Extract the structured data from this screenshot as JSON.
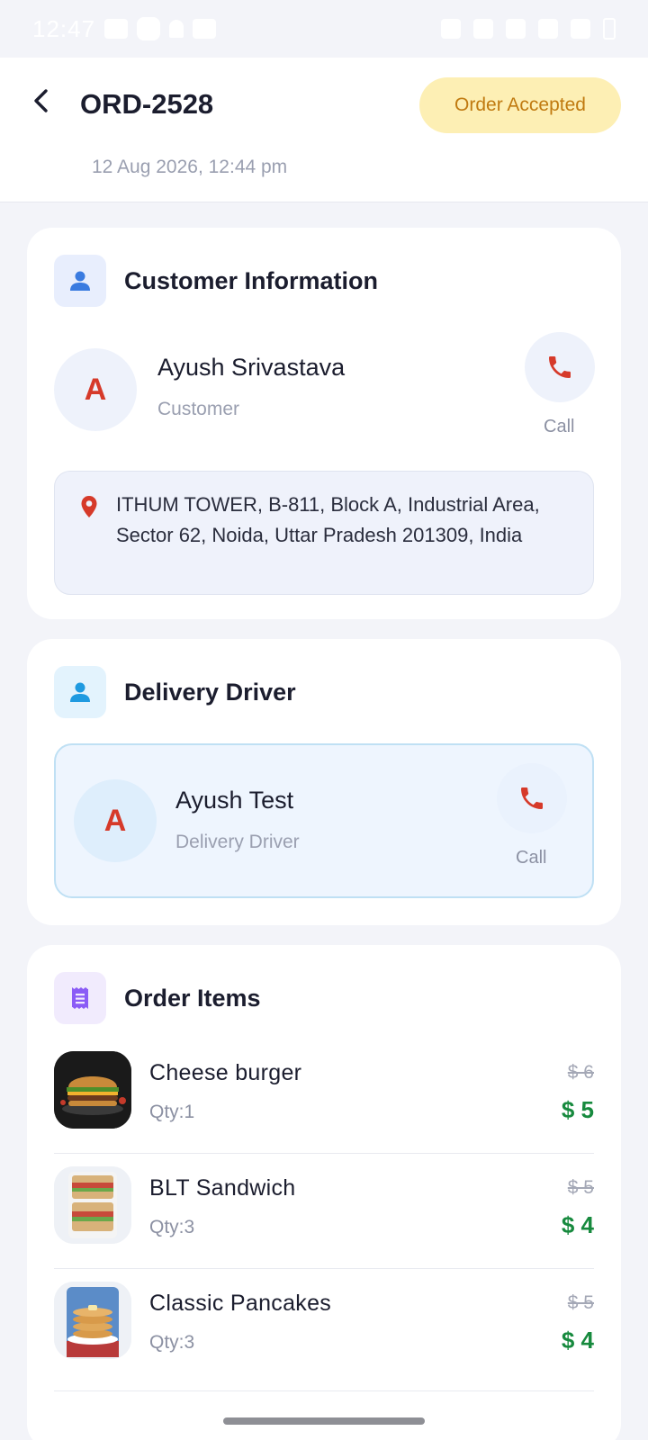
{
  "status_bar": {
    "time": "12:47"
  },
  "header": {
    "order_id": "ORD-2528",
    "date": "12 Aug 2026, 12:44 pm",
    "status": "Order Accepted"
  },
  "customer": {
    "section_title": "Customer Information",
    "initial": "A",
    "name": "Ayush Srivastava",
    "role": "Customer",
    "call_label": "Call",
    "address": "ITHUM TOWER, B-811, Block A, Industrial Area, Sector 62, Noida, Uttar Pradesh 201309, India"
  },
  "driver": {
    "section_title": "Delivery Driver",
    "initial": "A",
    "name": "Ayush Test",
    "role": "Delivery Driver",
    "call_label": "Call"
  },
  "order_items": {
    "section_title": "Order Items",
    "items": [
      {
        "name": "Cheese burger",
        "qty": "Qty:1",
        "old_price": "$ 6",
        "price": "$ 5"
      },
      {
        "name": "BLT Sandwich",
        "qty": "Qty:3",
        "old_price": "$ 5",
        "price": "$ 4"
      },
      {
        "name": "Classic Pancakes",
        "qty": "Qty:3",
        "old_price": "$ 5",
        "price": "$ 4"
      }
    ]
  },
  "colors": {
    "status_badge_bg": "#fdefb4",
    "status_badge_text": "#c07a10",
    "call_icon": "#d63a2a",
    "price_green": "#178a3e"
  }
}
